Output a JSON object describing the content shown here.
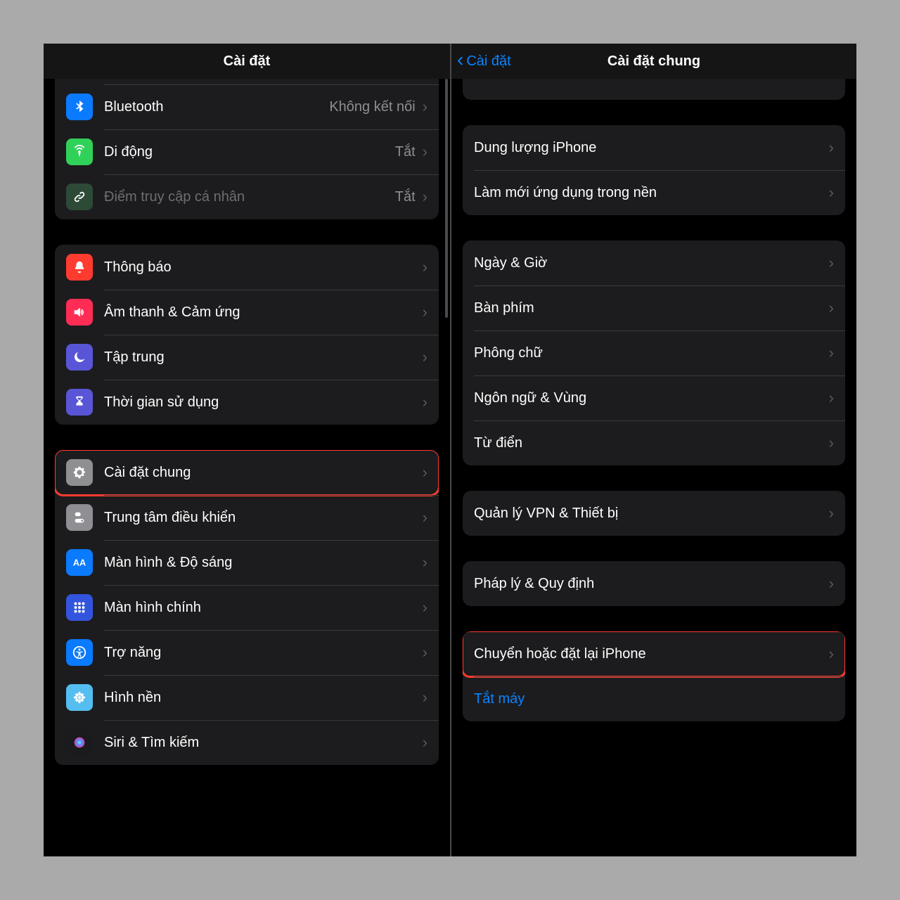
{
  "left": {
    "title": "Cài đặt",
    "groups": [
      {
        "topPartial": true,
        "rows": [
          {
            "id": "bluetooth",
            "label": "Bluetooth",
            "value": "Không kết nối",
            "iconBg": "#0a7aff",
            "iconKey": "bluetooth"
          },
          {
            "id": "mobile",
            "label": "Di động",
            "value": "Tắt",
            "iconBg": "#30d158",
            "iconKey": "antenna"
          },
          {
            "id": "hotspot",
            "label": "Điểm truy cập cá nhân",
            "value": "Tắt",
            "iconBg": "#2d4a37",
            "iconKey": "link",
            "dim": true
          }
        ]
      },
      {
        "rows": [
          {
            "id": "notifications",
            "label": "Thông báo",
            "iconBg": "#ff3b30",
            "iconKey": "bell"
          },
          {
            "id": "sounds",
            "label": "Âm thanh & Cảm ứng",
            "iconBg": "#ff2d55",
            "iconKey": "speaker"
          },
          {
            "id": "focus",
            "label": "Tập trung",
            "iconBg": "#5856d6",
            "iconKey": "moon"
          },
          {
            "id": "screentime",
            "label": "Thời gian sử dụng",
            "iconBg": "#5856d6",
            "iconKey": "hourglass"
          }
        ]
      },
      {
        "rows": [
          {
            "id": "general",
            "label": "Cài đặt chung",
            "iconBg": "#8e8e93",
            "iconKey": "gear",
            "highlight": true
          },
          {
            "id": "control-center",
            "label": "Trung tâm điều khiển",
            "iconBg": "#8e8e93",
            "iconKey": "switches"
          },
          {
            "id": "display",
            "label": "Màn hình & Độ sáng",
            "iconBg": "#0a7aff",
            "iconKey": "aa"
          },
          {
            "id": "home-screen",
            "label": "Màn hình chính",
            "iconBg": "#3355dd",
            "iconKey": "grid"
          },
          {
            "id": "accessibility",
            "label": "Trợ năng",
            "iconBg": "#0a7aff",
            "iconKey": "access"
          },
          {
            "id": "wallpaper",
            "label": "Hình nền",
            "iconBg": "#54bef0",
            "iconKey": "flower"
          },
          {
            "id": "siri",
            "label": "Siri & Tìm kiếm",
            "iconBg": "#1b1b1d",
            "iconKey": "siri"
          }
        ]
      }
    ]
  },
  "right": {
    "title": "Cài đặt chung",
    "back": "Cài đặt",
    "groups": [
      {
        "partial": true
      },
      {
        "rows": [
          {
            "id": "storage",
            "label": "Dung lượng iPhone"
          },
          {
            "id": "bg-refresh",
            "label": "Làm mới ứng dụng trong nền"
          }
        ]
      },
      {
        "rows": [
          {
            "id": "datetime",
            "label": "Ngày & Giờ"
          },
          {
            "id": "keyboard",
            "label": "Bàn phím"
          },
          {
            "id": "fonts",
            "label": "Phông chữ"
          },
          {
            "id": "language",
            "label": "Ngôn ngữ & Vùng"
          },
          {
            "id": "dictionary",
            "label": "Từ điển"
          }
        ]
      },
      {
        "rows": [
          {
            "id": "vpn",
            "label": "Quản lý VPN & Thiết bị"
          }
        ]
      },
      {
        "rows": [
          {
            "id": "legal",
            "label": "Pháp lý & Quy định"
          }
        ]
      },
      {
        "rows": [
          {
            "id": "transfer-reset",
            "label": "Chuyển hoặc đặt lại iPhone",
            "highlight": true
          },
          {
            "id": "shutdown",
            "label": "Tắt máy",
            "link": true,
            "noChevron": true
          }
        ]
      }
    ]
  }
}
